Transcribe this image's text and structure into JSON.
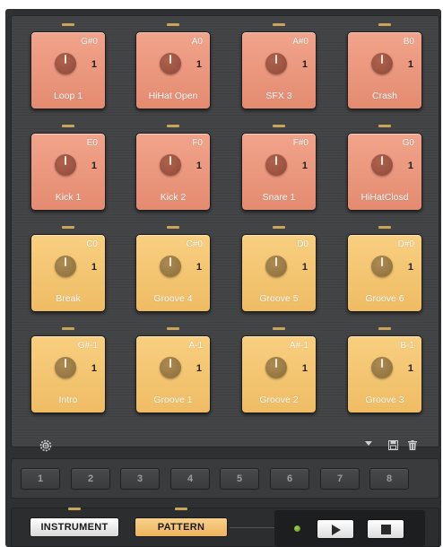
{
  "colors": {
    "pad_red": "#e8917a",
    "pad_yellow": "#f2c16d",
    "led_amber": "#c9a55a",
    "background_dark": "#2f3032",
    "pattern_active": "#f0b65c"
  },
  "pads": [
    {
      "note": "G#0",
      "value": "1",
      "label": "Loop 1",
      "color": "red"
    },
    {
      "note": "A0",
      "value": "1",
      "label": "HiHat Open",
      "color": "red"
    },
    {
      "note": "A#0",
      "value": "1",
      "label": "SFX 3",
      "color": "red"
    },
    {
      "note": "B0",
      "value": "1",
      "label": "Crash",
      "color": "red"
    },
    {
      "note": "E0",
      "value": "1",
      "label": "Kick 1",
      "color": "red"
    },
    {
      "note": "F0",
      "value": "1",
      "label": "Kick 2",
      "color": "red"
    },
    {
      "note": "F#0",
      "value": "1",
      "label": "Snare 1",
      "color": "red"
    },
    {
      "note": "G0",
      "value": "1",
      "label": "HiHatClosd",
      "color": "red"
    },
    {
      "note": "C0",
      "value": "1",
      "label": "Break",
      "color": "yellow"
    },
    {
      "note": "C#0",
      "value": "1",
      "label": "Groove 4",
      "color": "yellow"
    },
    {
      "note": "D0",
      "value": "1",
      "label": "Groove 5",
      "color": "yellow"
    },
    {
      "note": "D#0",
      "value": "1",
      "label": "Groove 6",
      "color": "yellow"
    },
    {
      "note": "G#-1",
      "value": "1",
      "label": "Intro",
      "color": "yellow"
    },
    {
      "note": "A-1",
      "value": "1",
      "label": "Groove 1",
      "color": "yellow"
    },
    {
      "note": "A#-1",
      "value": "1",
      "label": "Groove 2",
      "color": "yellow"
    },
    {
      "note": "B-1",
      "value": "1",
      "label": "Groove 3",
      "color": "yellow"
    }
  ],
  "utility_bar": {
    "left_icon": "settings-gear-b-icon",
    "right_icons": [
      "dropdown-arrow-icon",
      "save-disk-icon",
      "trash-icon"
    ]
  },
  "patterns": [
    "1",
    "2",
    "3",
    "4",
    "5",
    "6",
    "7",
    "8"
  ],
  "bottom": {
    "instrument_label": "INSTRUMENT",
    "pattern_label": "PATTERN",
    "active_mode": "PATTERN"
  },
  "transport": {
    "status_led": "green",
    "play_icon": "play-icon",
    "stop_icon": "stop-icon"
  }
}
